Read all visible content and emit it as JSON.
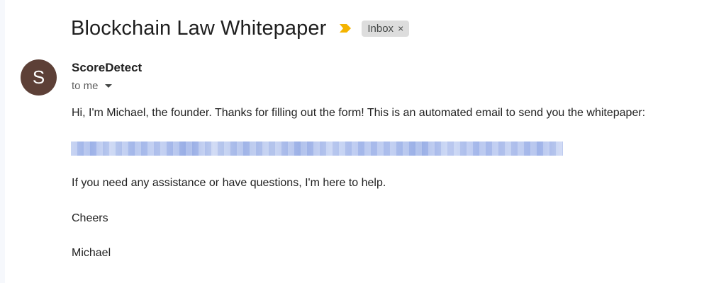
{
  "email": {
    "subject": "Blockchain Law Whitepaper",
    "label": "Inbox",
    "label_remove": "×",
    "importance_color": "#f4b400",
    "sender": {
      "avatar_letter": "S",
      "avatar_color": "#5d4037",
      "name": "ScoreDetect",
      "recipient": "to me"
    },
    "body": {
      "intro": "Hi, I'm Michael, the founder. Thanks for filling out the form! This is an automated email to send you the whitepaper:",
      "help": "If you need any assistance or have questions, I'm here to help.",
      "signoff": "Cheers",
      "signature": "Michael"
    }
  }
}
